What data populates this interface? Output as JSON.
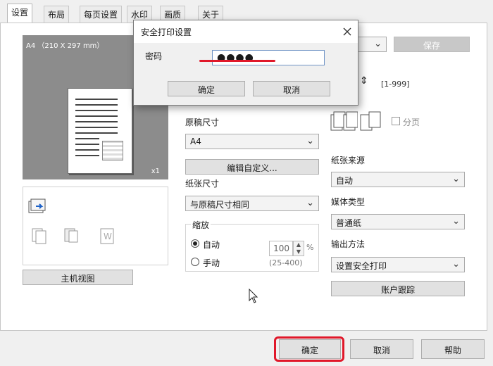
{
  "tabs": [
    "设置",
    "布局",
    "每页设置",
    "水印",
    "画质",
    "关于"
  ],
  "preview": {
    "paper_label": "A4 （210 X 297 mm）",
    "copies_badge": "x1"
  },
  "host_view_button": "主机视图",
  "top_right": {
    "save_button": "保存"
  },
  "copies": {
    "range": "[1-999]"
  },
  "collate_label": "分页",
  "original_size": {
    "label": "原稿尺寸",
    "value": "A4"
  },
  "edit_custom_button": "编辑自定义...",
  "paper_size": {
    "label": "纸张尺寸",
    "value": "与原稿尺寸相同"
  },
  "zoom": {
    "group_label": "缩放",
    "auto_label": "自动",
    "manual_label": "手动",
    "value": "100",
    "unit": "%",
    "range": "(25-400)"
  },
  "paper_source": {
    "label": "纸张来源",
    "value": "自动"
  },
  "media_type": {
    "label": "媒体类型",
    "value": "普通纸"
  },
  "output_method": {
    "label": "输出方法",
    "value": "设置安全打印"
  },
  "account_track_button": "账户跟踪",
  "footer": {
    "ok": "确定",
    "cancel": "取消",
    "help": "帮助"
  },
  "dialog": {
    "title": "安全打印设置",
    "password_label": "密码",
    "password_value": "●●●●",
    "ok": "确定",
    "cancel": "取消",
    "close_icon": "close-icon"
  },
  "colors": {
    "annotation_red": "#e0182a",
    "input_focus_border": "#6f93c5"
  }
}
